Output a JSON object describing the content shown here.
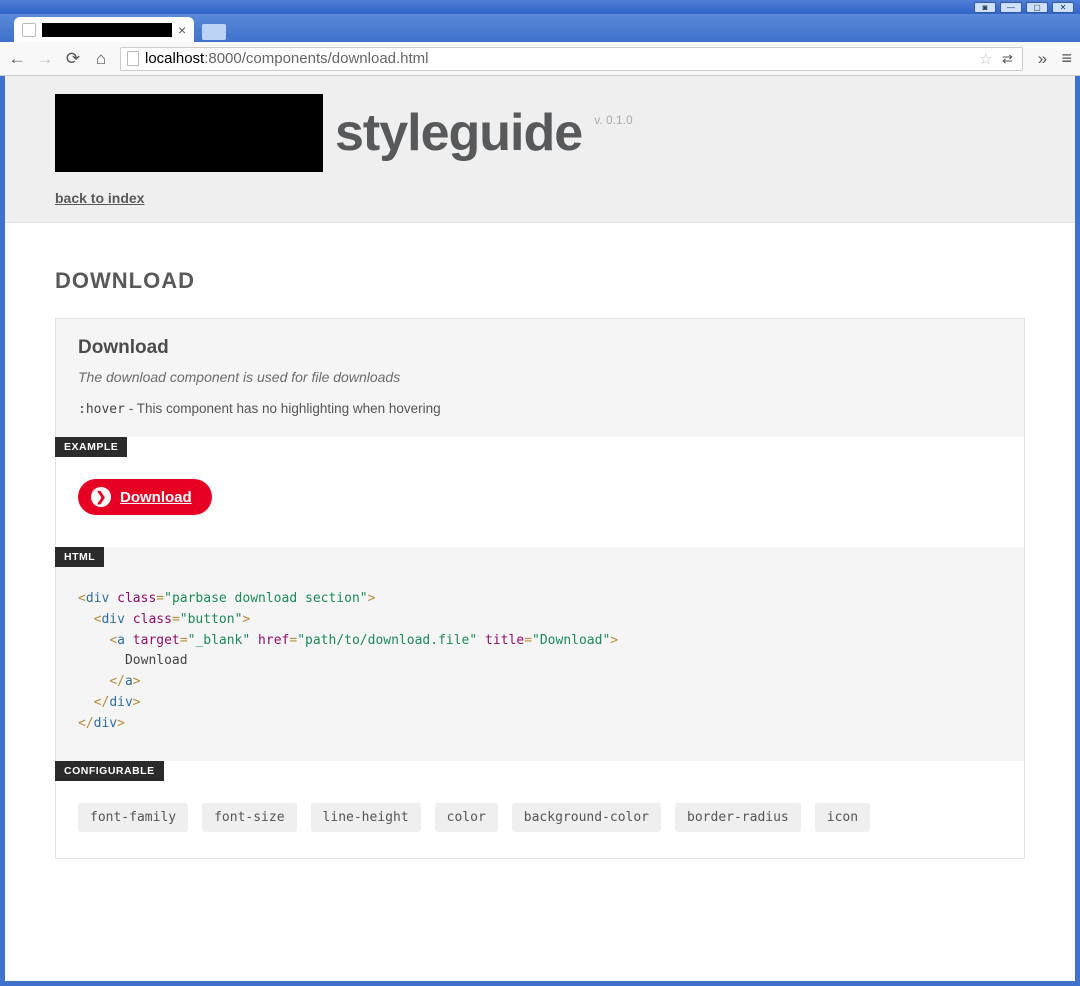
{
  "browser": {
    "url_host": "localhost",
    "url_path": ":8000/components/download.html",
    "back_disabled": false,
    "forward_disabled": true
  },
  "header": {
    "title": "styleguide",
    "version": "v. 0.1.0",
    "back_link": "back to index"
  },
  "section": {
    "title": "DOWNLOAD",
    "component_name": "Download",
    "description": "The download component is used for file downloads",
    "hover_selector": ":hover",
    "hover_text": " - This component has no highlighting when hovering"
  },
  "labels": {
    "example": "EXAMPLE",
    "html": "HTML",
    "configurable": "CONFIGURABLE"
  },
  "example": {
    "button_label": "Download"
  },
  "code": {
    "class_outer": "parbase download section",
    "class_inner": "button",
    "a_target": "_blank",
    "a_href": "path/to/download.file",
    "a_title": "Download",
    "a_text": "Download"
  },
  "configurable": [
    "font-family",
    "font-size",
    "line-height",
    "color",
    "background-color",
    "border-radius",
    "icon"
  ]
}
